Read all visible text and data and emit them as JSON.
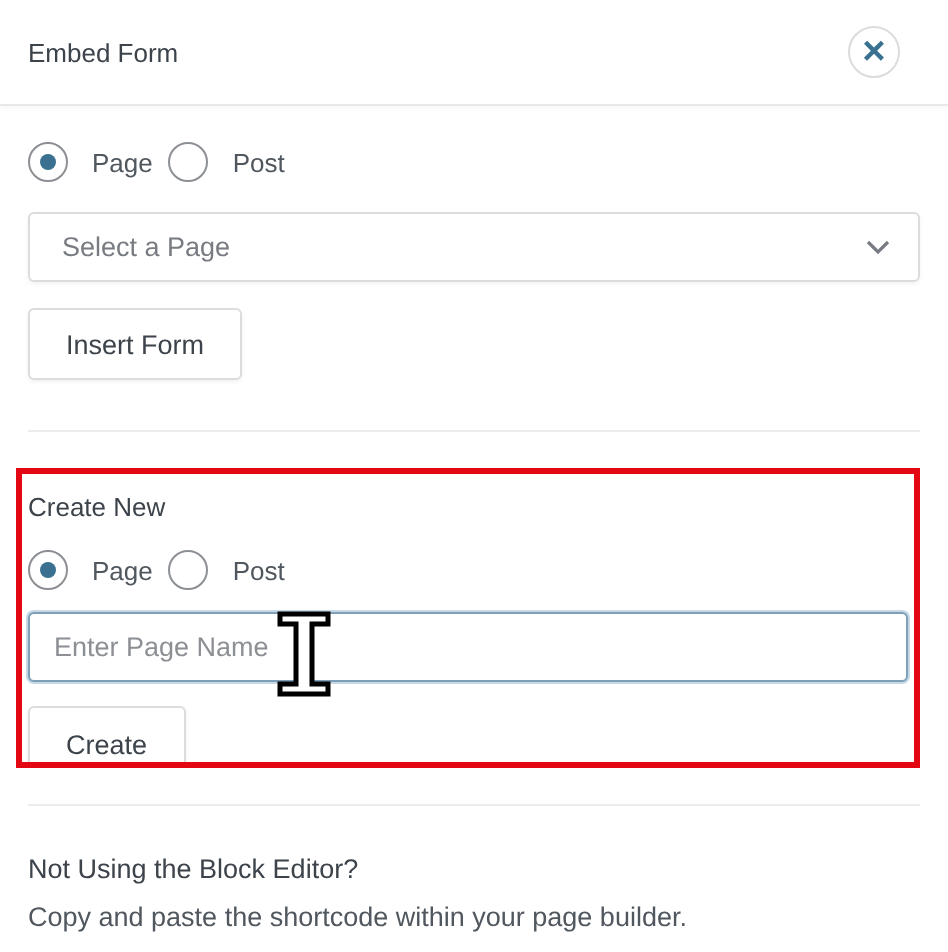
{
  "header": {
    "title": "Embed Form",
    "close_icon": "×"
  },
  "existing": {
    "options": [
      {
        "label": "Page",
        "selected": true
      },
      {
        "label": "Post",
        "selected": false
      }
    ],
    "select": {
      "placeholder": "Select a Page"
    },
    "button": "Insert Form"
  },
  "create_new": {
    "heading": "Create New",
    "highlighted": true,
    "options": [
      {
        "label": "Page",
        "selected": true
      },
      {
        "label": "Post",
        "selected": false
      }
    ],
    "input": {
      "placeholder": "Enter Page Name"
    },
    "button": "Create"
  },
  "block_editor": {
    "heading": "Not Using the Block Editor?",
    "text": "Copy and paste the shortcode within your page builder."
  }
}
